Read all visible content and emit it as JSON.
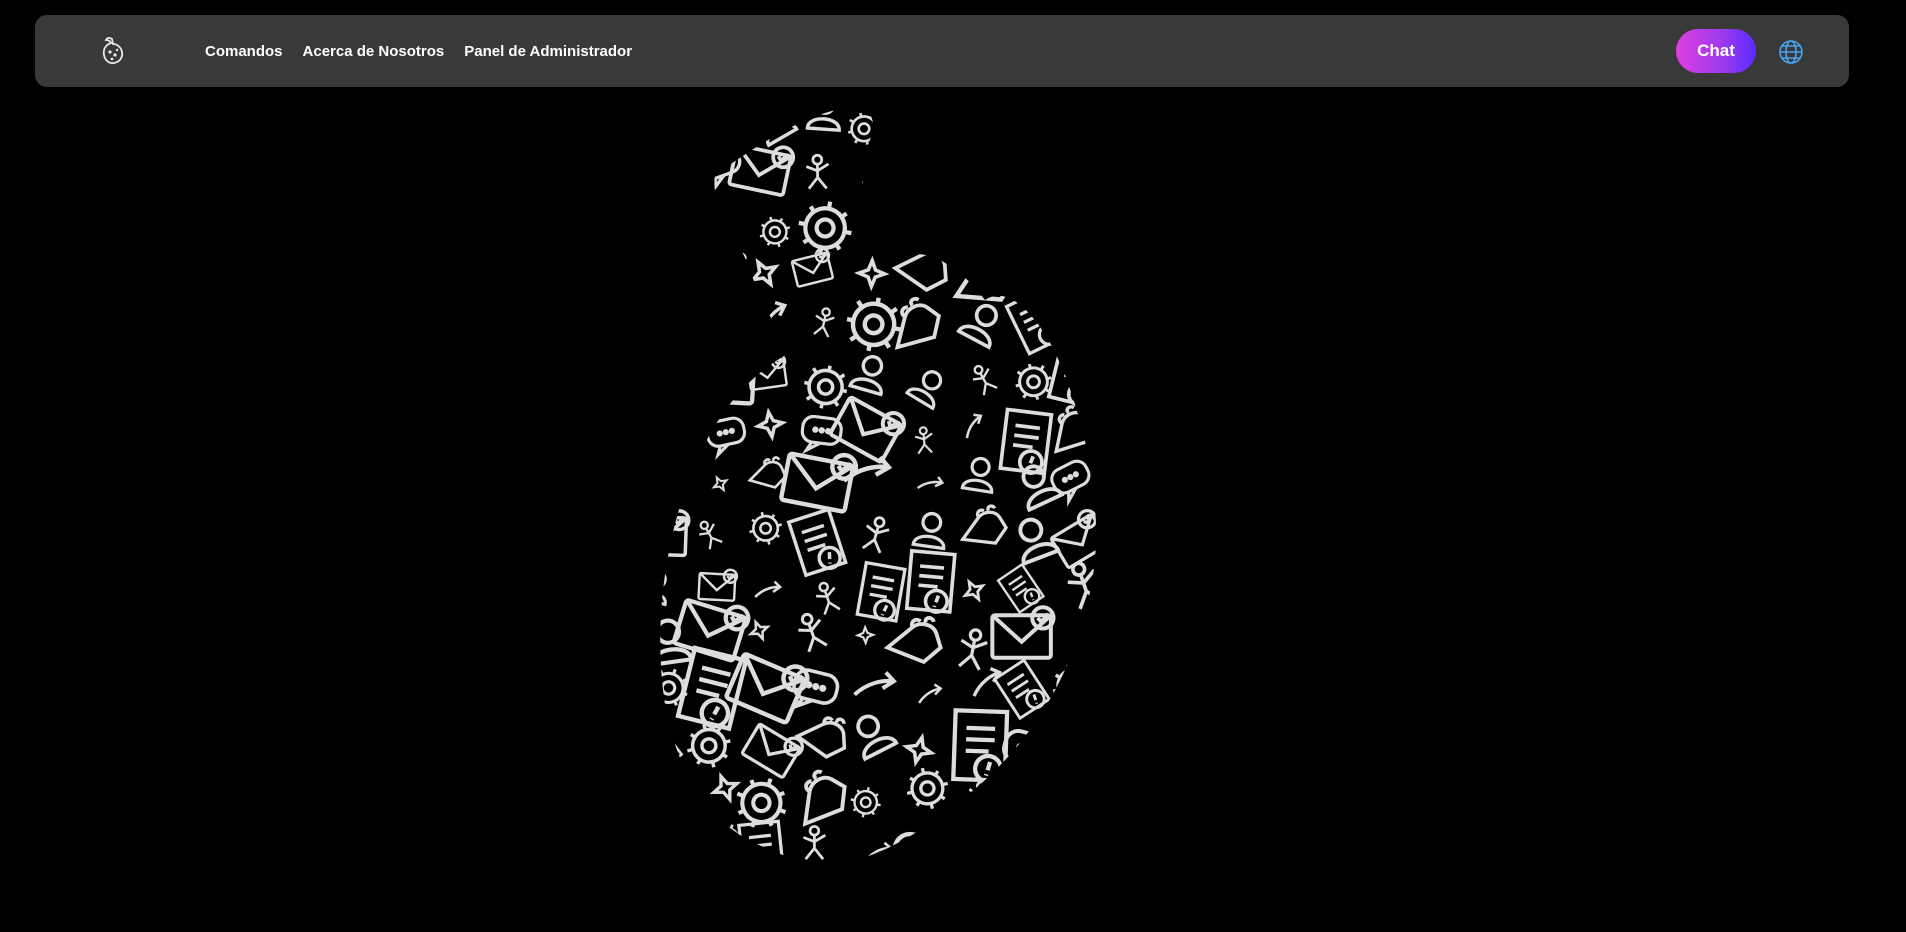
{
  "navbar": {
    "logo_icon": "drop-logo-icon",
    "links": [
      {
        "label": "Comandos"
      },
      {
        "label": "Acerca de Nosotros"
      },
      {
        "label": "Panel de Administrador"
      }
    ],
    "chat_label": "Chat",
    "language_icon": "globe-icon"
  },
  "hero": {
    "image_icon": "drop-doodle-illustration",
    "colors": {
      "background": "#000000",
      "stroke": "#ffffff"
    }
  },
  "colors": {
    "nav_background": "#393939",
    "chat_gradient_start": "#e13fe0",
    "chat_gradient_end": "#5a2bff",
    "globe": "#4aa3f0"
  }
}
